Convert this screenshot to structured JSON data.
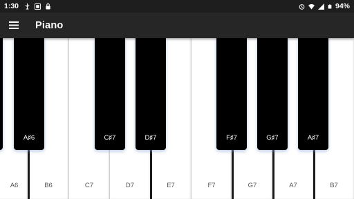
{
  "status_bar": {
    "time": "1:30",
    "battery": "94%",
    "icons": [
      "usb-debug-icon",
      "screenshot-icon",
      "lock-icon",
      "alarm-icon",
      "wifi-icon",
      "signal-icon",
      "battery-icon"
    ]
  },
  "app_bar": {
    "title": "Piano",
    "menu_icon": "hamburger-menu-icon"
  },
  "keyboard": {
    "white_keys": [
      "A6",
      "B6",
      "C7",
      "D7",
      "E7",
      "F7",
      "G7",
      "A7",
      "B7"
    ],
    "black_keys": [
      "A♯6",
      "C♯7",
      "D♯7",
      "F♯7",
      "G♯7",
      "A♯7"
    ]
  },
  "colors": {
    "status_bar": "#1e1e1e",
    "app_bar": "#262626",
    "black_key": "#000000",
    "white_key": "#ffffff",
    "black_key_glow": "#7896c8"
  }
}
